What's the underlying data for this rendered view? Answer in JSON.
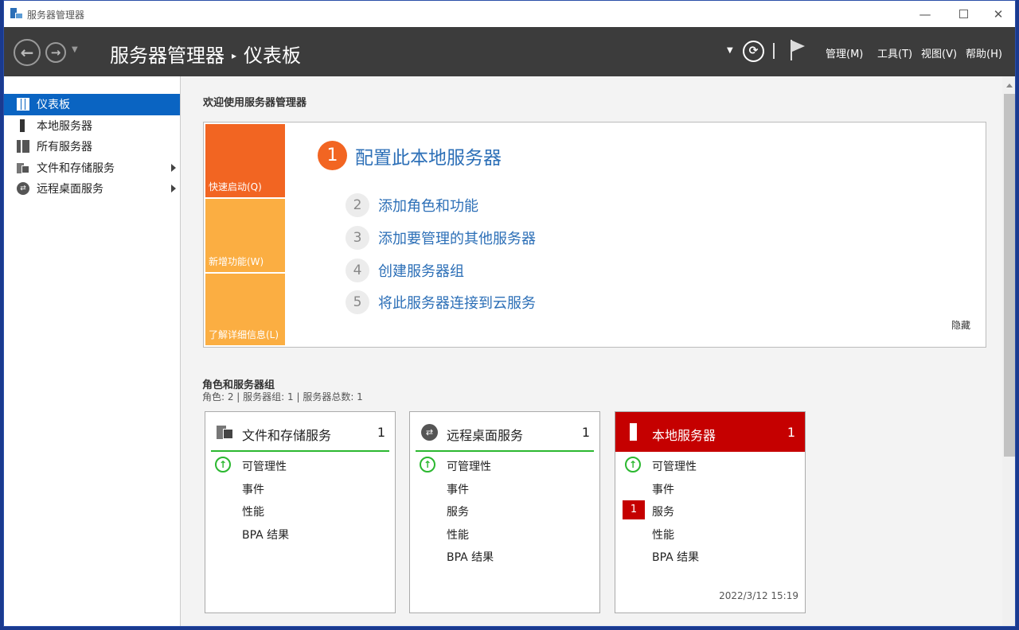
{
  "window": {
    "title": "服务器管理器",
    "controls": {
      "minimize": "—",
      "close": "✕"
    }
  },
  "header": {
    "breadcrumb_root": "服务器管理器",
    "breadcrumb_separator": "▸",
    "breadcrumb_current": "仪表板",
    "menus": [
      "管理(M)",
      "工具(T)",
      "视图(V)",
      "帮助(H)"
    ]
  },
  "sidebar": {
    "items": [
      {
        "label": "仪表板",
        "icon": "dashboard-icon",
        "active": true
      },
      {
        "label": "本地服务器",
        "icon": "server-icon"
      },
      {
        "label": "所有服务器",
        "icon": "servers-icon"
      },
      {
        "label": "文件和存储服务",
        "icon": "file-storage-icon",
        "expandable": true
      },
      {
        "label": "远程桌面服务",
        "icon": "remote-desktop-icon",
        "expandable": true
      }
    ]
  },
  "welcome": {
    "title": "欢迎使用服务器管理器"
  },
  "quickstart": {
    "tiles": [
      "快速启动(Q)",
      "新增功能(W)",
      "了解详细信息(L)"
    ],
    "steps": [
      {
        "num": "1",
        "label": "配置此本地服务器"
      },
      {
        "num": "2",
        "label": "添加角色和功能"
      },
      {
        "num": "3",
        "label": "添加要管理的其他服务器"
      },
      {
        "num": "4",
        "label": "创建服务器组"
      },
      {
        "num": "5",
        "label": "将此服务器连接到云服务"
      }
    ],
    "hide_label": "隐藏"
  },
  "roles": {
    "title": "角色和服务器组",
    "summary": "角色: 2 | 服务器组: 1 | 服务器总数: 1",
    "cards": [
      {
        "title": "文件和存储服务",
        "count": "1",
        "rows": [
          "可管理性",
          "事件",
          "性能",
          "BPA 结果"
        ]
      },
      {
        "title": "远程桌面服务",
        "count": "1",
        "rows": [
          "可管理性",
          "事件",
          "服务",
          "性能",
          "BPA 结果"
        ]
      },
      {
        "title": "本地服务器",
        "count": "1",
        "rows": [
          "可管理性",
          "事件",
          "服务",
          "性能",
          "BPA 结果"
        ],
        "alert_count": "1",
        "timestamp": "2022/3/12 15:19"
      }
    ]
  },
  "colors": {
    "header_bg": "#3c3c3c",
    "active_nav": "#0a64c2",
    "quickstart_orange": "#f26522",
    "tile_amber": "#fbae42",
    "link_blue": "#2c6fb7",
    "ok_green": "#2bb830",
    "alert_red": "#c50000"
  }
}
